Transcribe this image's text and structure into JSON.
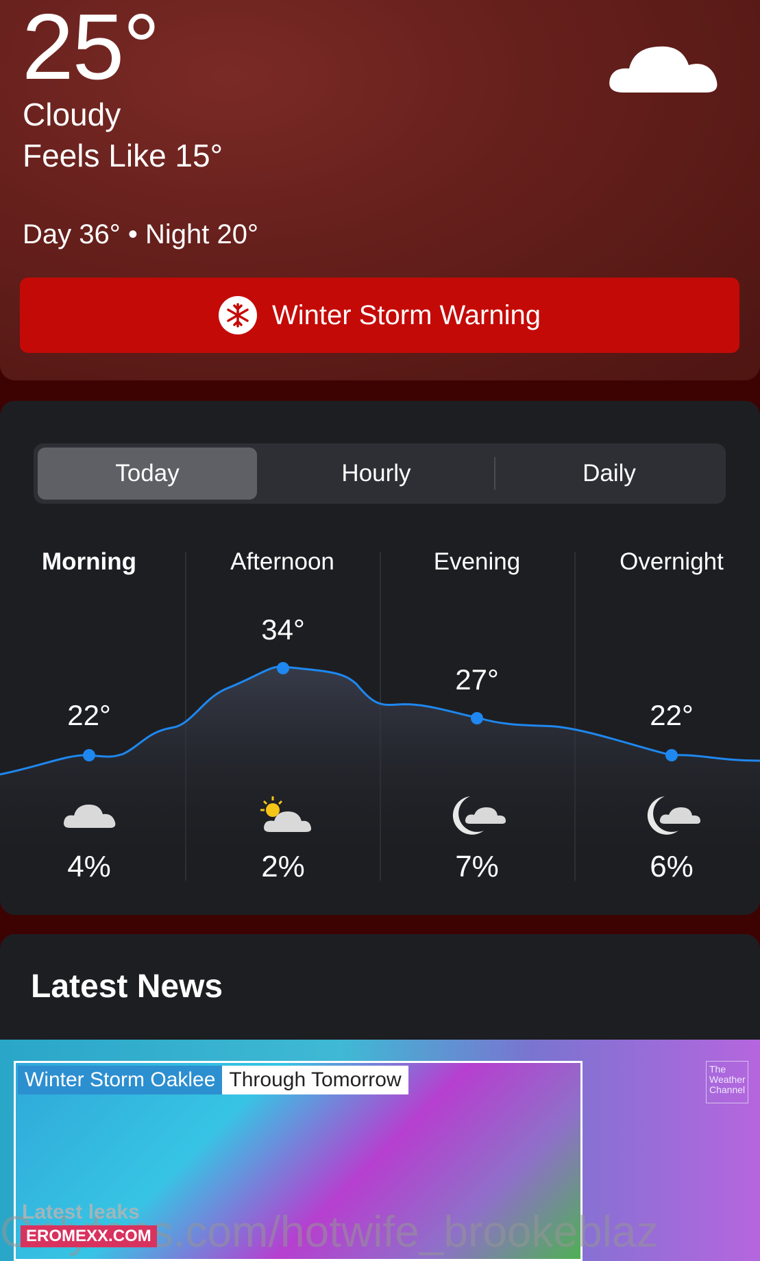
{
  "current": {
    "temperature": "25°",
    "condition": "Cloudy",
    "feels_like": "Feels Like 15°",
    "day_night": "Day 36° • Night 20°",
    "icon": "cloud-icon"
  },
  "alert": {
    "label": "Winter Storm Warning",
    "icon": "snowflake-icon",
    "color": "#c40a07"
  },
  "tabs": [
    {
      "label": "Today",
      "active": true
    },
    {
      "label": "Hourly",
      "active": false
    },
    {
      "label": "Daily",
      "active": false
    }
  ],
  "periods": [
    {
      "label": "Morning",
      "temp": "22°",
      "precip": "4%",
      "icon": "cloud-icon"
    },
    {
      "label": "Afternoon",
      "temp": "34°",
      "precip": "2%",
      "icon": "partly-sunny-icon"
    },
    {
      "label": "Evening",
      "temp": "27°",
      "precip": "7%",
      "icon": "moon-cloud-icon"
    },
    {
      "label": "Overnight",
      "temp": "22°",
      "precip": "6%",
      "icon": "moon-cloud-icon"
    }
  ],
  "news": {
    "heading": "Latest News",
    "map_title_1": "Winter Storm Oaklee",
    "map_title_2": "Through Tomorrow",
    "brand": "The Weather Channel"
  },
  "watermark": {
    "url": "Onlyfans.com/hotwife_brookeblaz",
    "line1": "Latest leaks",
    "line2": "EROMEXX.COM"
  },
  "colors": {
    "accent_line": "#1e88f0",
    "card_bg": "#1d1e22"
  }
}
